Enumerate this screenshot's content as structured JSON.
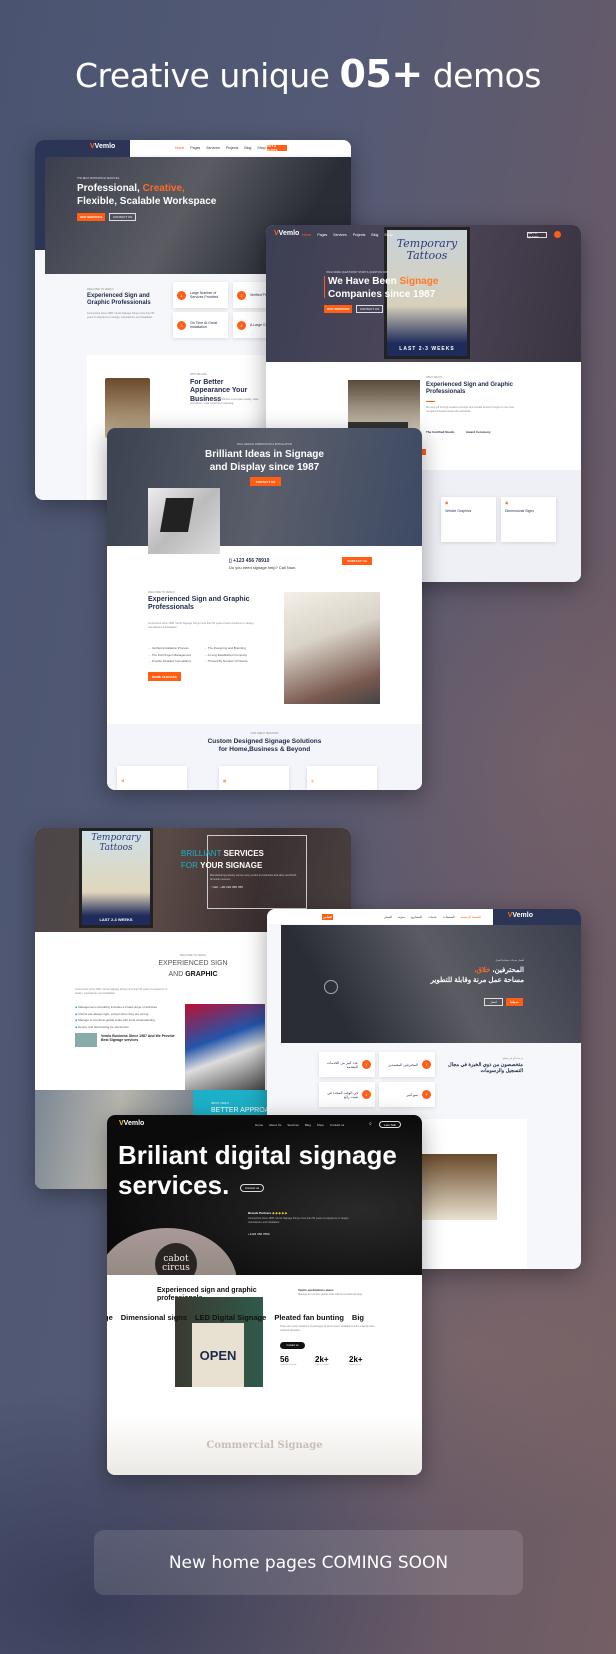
{
  "header": {
    "title_pre": "Creative unique ",
    "title_num": "05+",
    "title_post": " demos"
  },
  "colors": {
    "accent": "#ff5e14",
    "navy": "#27304d",
    "teal": "#1db1c9"
  },
  "demo1": {
    "logo": "Vemlo",
    "nav": [
      "Home",
      "Pages",
      "Services",
      "Projects",
      "Blog",
      "Shop"
    ],
    "cta": "GET A QUOTE",
    "eyebrow": "THE BEST WORKSPACE SERVICES",
    "hero_l1a": "Professional, ",
    "hero_l1b": "Creative,",
    "hero_l2": "Flexible, Scalable Workspace",
    "btn1": "OUR SERVICES",
    "btn2": "CONTACT US",
    "welcome": "WELCOME TO VEMLO",
    "section_title": "Experienced Sign and Graphic Professionals",
    "section_text": "Connecticut since 1965, Vemlo Signage brings more than 50 years of experience in design, manufacture and installation.",
    "features": [
      {
        "n": "1",
        "label": "Large Number of Services Provided"
      },
      {
        "n": "2",
        "label": "Verified Professionals"
      },
      {
        "n": "3",
        "label": "On Time At Great Installation"
      },
      {
        "n": "4",
        "label": "A Large Growth"
      }
    ],
    "about_eyebrow": "WHO WE ARE",
    "about_title": "For Better Appearance Your Business",
    "about_text": "Your business experience should be encompass quality, sales promotions, retail media and marketing."
  },
  "demo2": {
    "logo": "Vemlo",
    "nav": [
      "Home",
      "Pages",
      "Services",
      "Projects",
      "Blog",
      "Shop"
    ],
    "cta": "GET A QUOTE",
    "eyebrow": "HAVE MORE QUESTIONS? START A QUESTION NOW",
    "hero_l1a": "We Have Been ",
    "hero_l1b": "Signage",
    "hero_l2": "Companies since 1987",
    "btn1": "OUR SERVICES",
    "btn2": "CONTACT US",
    "sign_text": "Temporary Tattoos",
    "sign_footer": "LAST 2-3 WEEKS",
    "about_eyebrow": "WHAT WE DO",
    "section_title": "Experienced Sign and Graphic Professionals",
    "section_text": "We stay tuff through creative concepts and provide all kind of signs for the most recognized brands across the worldwide.",
    "feat1": "The Certified Studio",
    "feat2": "Award Ceremony",
    "more_btn": "MORE",
    "badge_text": "NATURE",
    "services": [
      "Vehicle Graphics",
      "Dimensional Signs"
    ]
  },
  "demo3": {
    "eyebrow": "WALL DESIGN, FABRICATION & INSTALLATION",
    "hero_l1": "Brilliant Ideas in Signage",
    "hero_l2": "and Display since 1987",
    "btn": "CONTACT US",
    "phone": "+123 456 78910",
    "phone_sub": "Do you need signage help? Call Now.",
    "contact_btn": "CONTACT US",
    "welcome": "WELCOME TO VEMLO",
    "section_title": "Experienced Sign and Graphic Professionals",
    "section_text": "Connecticut since 1965, Vemlo Signage brings more than 50 years of well experience in design, manufacture & installation.",
    "list_left": [
      "Verified Installation Process",
      "The Full Project Management",
      "Provide Detailed Consultancy"
    ],
    "list_right": [
      "The Designing and Branding",
      "A Long Established Company",
      "Trusted By Number Of Clients"
    ],
    "more_btn": "MORE SERVICES",
    "services_eyebrow": "OUR GREAT SERVICES",
    "services_l1": "Custom Designed Signage Solutions",
    "services_l2": "for Home,Business & Beyond"
  },
  "demo4": {
    "hero_a1": "BRILLIANT ",
    "hero_b1": "SERVICES",
    "hero_a2": "FOR ",
    "hero_b2": "YOUR SIGNAGE",
    "hero_text": "Manufacturing industry service every series of production and silver and North American sources.",
    "call": "Call : +00 123 456 789",
    "sign_text": "Temporary Tattoos",
    "sign_footer": "LAST 2-3 WEEKS",
    "welcome": "WELCOME TO VEMLO",
    "title_a": "EXPERIENCED SIGN",
    "title_b": "AND ",
    "title_c": "GRAPHIC",
    "text": "Connecticut since 1965, Vemlo Signage brings more than 50 years of experience in design, manufacture and installation.",
    "list": [
      "Management consulting includes a broad range of activities",
      "Clients are always right, except when they are wrong",
      "Manage to Combine global scale with local understanding",
      "Device and field testing for electronics"
    ],
    "note": "Vemlo Business Since 1987 And We Provide Best Signage services",
    "about_eyebrow": "ABOUT VEMLO",
    "about_title": "BETTER APPROACH"
  },
  "demo5": {
    "logo": "Vemlo",
    "nav": [
      "الصفحة الرئيسية",
      "الصفحات",
      "خدمات",
      "المشاريع",
      "مدونة",
      "المتجر"
    ],
    "cta": "اقتباس",
    "eyebrow": "أفضل خدمات مساحة العمل",
    "hero_l1a": "المحترفين، ",
    "hero_l1b": "خلاق،",
    "hero_l2": "مساحة عمل مرنة وقابلة للتطوير",
    "btn1": "خدماتنا",
    "btn2": "اتصل",
    "welcome": "مرحبا بكم في فيملو",
    "section_title": "متخصصون من ذوي الخبرة في مجال التسجيل والرسومات",
    "features": [
      "عدد كبير من الخدمات المقدمة",
      "المحترفين المعتمدين",
      "في الوقت المحدد في تثبيت رائع",
      "نمو كبير"
    ]
  },
  "demo6": {
    "logo": "Vemlo",
    "nav": [
      "Home",
      "About Us",
      "Services",
      "Blog",
      "Shop",
      "Contact us"
    ],
    "talk_btn": "Lets Talk",
    "hero_l1": "Briliant digital signage",
    "hero_l2": "services.",
    "contact_btn": "Contact us",
    "partners_label": "Brands Partners",
    "hero_text": "Connecticut since 1965, Vemlo Signage brings more than 50 years of experience in design, manufacture and installation.",
    "hero_phone": "+1123 456 7890",
    "photo_text": "cabot circus",
    "section_title": "Experienced sign and graphic professionals",
    "plans_title": "Vemlo spelizations plans",
    "plans_text": "Manage to Combine global scale with local understanding",
    "marquee": [
      "ge",
      "Dimensional signs",
      "LED Digital Signage",
      "Pleated fan bunting",
      "Big"
    ],
    "open_sign": "OPEN",
    "body_text": "There are many variations of passages of lorem ipsum available but the majority have suffered alteration.",
    "btn": "Contact us",
    "stats": [
      {
        "value": "56",
        "label": "Countries covered"
      },
      {
        "value": "2k+",
        "label": "Project finished"
      },
      {
        "value": "2k+",
        "label": "Happy clients"
      }
    ],
    "bottom_title": "Commercial Signage"
  },
  "footer": {
    "coming_soon": "New home pages COMING SOON"
  }
}
